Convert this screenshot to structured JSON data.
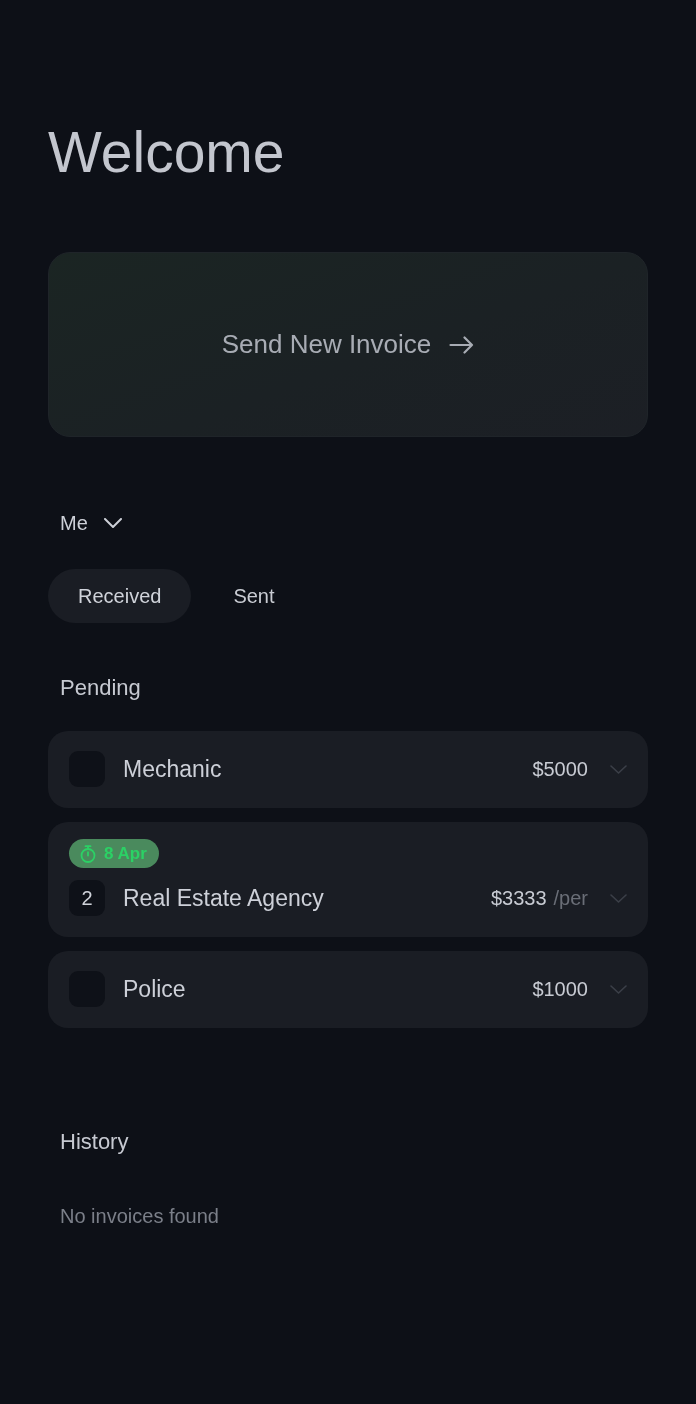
{
  "title": "Welcome",
  "send_button": {
    "label": "Send New Invoice"
  },
  "account_selector": {
    "label": "Me"
  },
  "tabs": [
    {
      "label": "Received",
      "selected": true
    },
    {
      "label": "Sent",
      "selected": false
    }
  ],
  "pending": {
    "heading": "Pending",
    "invoices": [
      {
        "name": "Mechanic",
        "amount": "$5000",
        "expanded": false
      },
      {
        "due": "8 Apr",
        "count": "2",
        "name": "Real Estate Agency",
        "amount": "$3333",
        "period": "/per",
        "expanded": false
      },
      {
        "name": "Police",
        "amount": "$1000",
        "expanded": false
      }
    ]
  },
  "history": {
    "heading": "History",
    "empty_message": "No invoices found"
  }
}
